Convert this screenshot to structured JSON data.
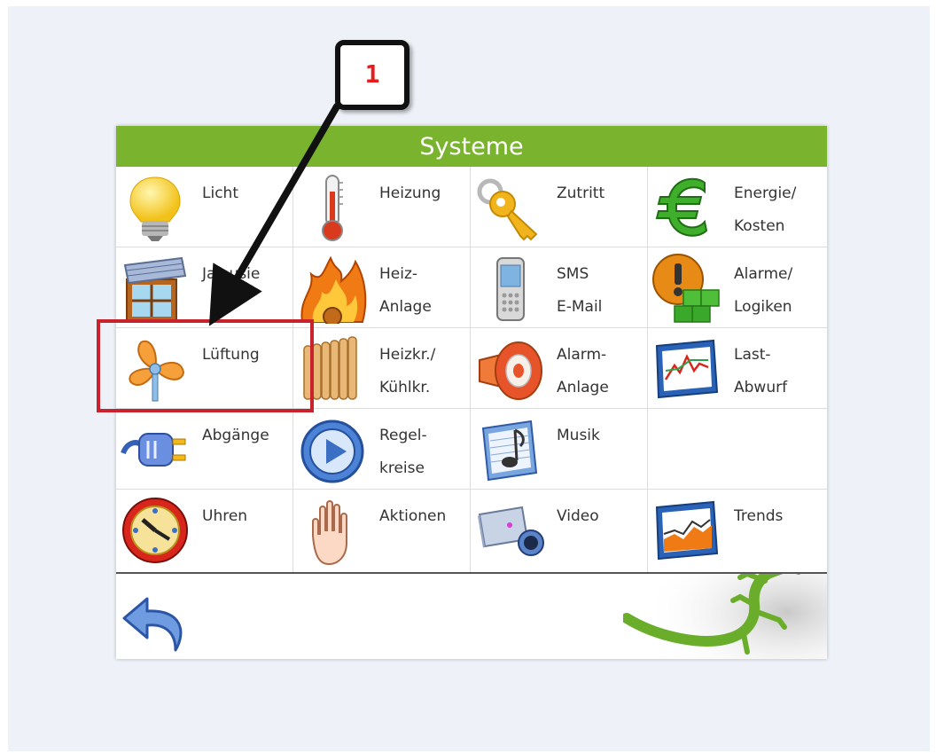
{
  "header": {
    "title": "Systeme"
  },
  "tiles": [
    {
      "label": "Licht",
      "icon": "lightbulb-icon"
    },
    {
      "label": "Heizung",
      "icon": "thermometer-icon"
    },
    {
      "label": "Zutritt",
      "icon": "key-icon"
    },
    {
      "label": "Energie/\nKosten",
      "icon": "euro-icon"
    },
    {
      "label": "Jalousie",
      "icon": "blinds-window-icon"
    },
    {
      "label": "Heiz-\nAnlage",
      "icon": "fire-icon"
    },
    {
      "label": "SMS\nE-Mail",
      "icon": "mobile-phone-icon"
    },
    {
      "label": "Alarme/\nLogiken",
      "icon": "warning-cubes-icon"
    },
    {
      "label": "Lüftung",
      "icon": "fan-icon"
    },
    {
      "label": "Heizkr./\nKühlkr.",
      "icon": "radiator-icon"
    },
    {
      "label": "Alarm-\nAnlage",
      "icon": "siren-horn-icon"
    },
    {
      "label": "Last-\nAbwurf",
      "icon": "chart-monitor-icon"
    },
    {
      "label": "Abgänge",
      "icon": "power-plug-icon"
    },
    {
      "label": "Regel-\nkreise",
      "icon": "play-circle-icon"
    },
    {
      "label": "Musik",
      "icon": "music-note-icon"
    },
    {
      "label": "",
      "icon": ""
    },
    {
      "label": "Uhren",
      "icon": "clock-icon"
    },
    {
      "label": "Aktionen",
      "icon": "hand-icon"
    },
    {
      "label": "Video",
      "icon": "video-camera-icon"
    },
    {
      "label": "Trends",
      "icon": "trend-chart-icon"
    }
  ],
  "footer": {
    "back_icon": "back-arrow-icon",
    "logo_icon": "gecko-logo-icon"
  },
  "annotation": {
    "step_number": "1",
    "highlight_target": "Lüftung"
  },
  "colors": {
    "header_green": "#7ab32e",
    "annotation_red": "#e51c1c",
    "highlight_red": "#c8232c",
    "gecko_green": "#6aad2a"
  }
}
